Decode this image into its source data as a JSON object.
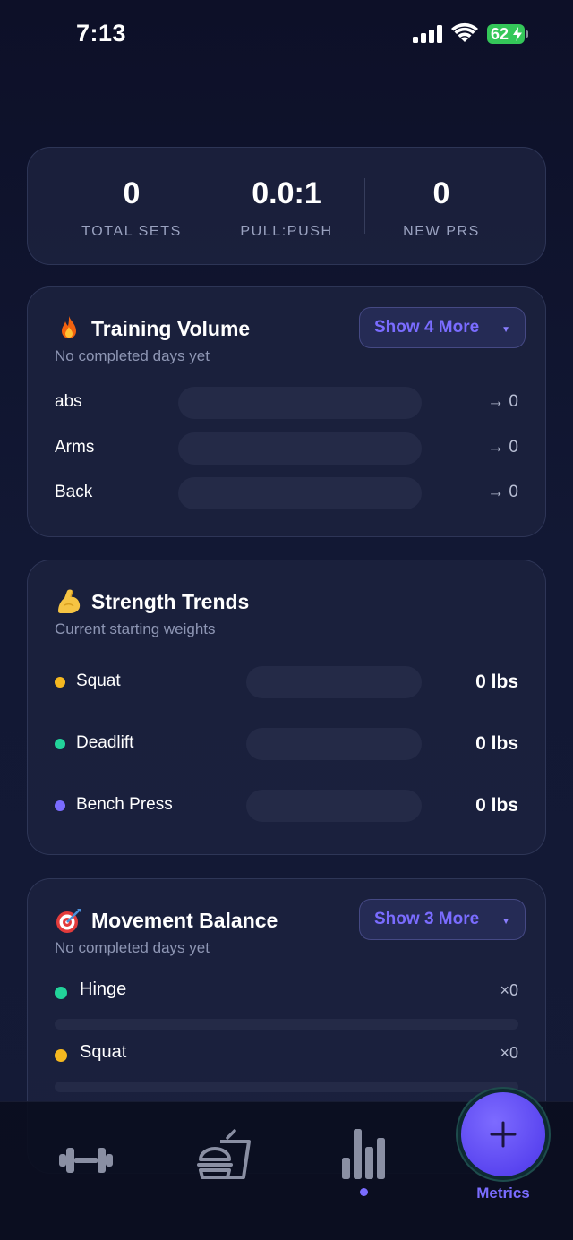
{
  "status_bar": {
    "time": "7:13",
    "battery": "62"
  },
  "stats": [
    {
      "value": "0",
      "label": "TOTAL SETS"
    },
    {
      "value": "0.0:1",
      "label": "PULL:PUSH"
    },
    {
      "value": "0",
      "label": "NEW PRS"
    }
  ],
  "training_volume": {
    "title": "Training Volume",
    "subtitle": "No completed days yet",
    "more_label": "Show 4 More",
    "rows": [
      {
        "label": "abs",
        "value": "→ 0"
      },
      {
        "label": "Arms",
        "value": "→ 0"
      },
      {
        "label": "Back",
        "value": "→ 0"
      }
    ]
  },
  "strength_trends": {
    "title": "Strength Trends",
    "subtitle": "Current starting weights",
    "rows": [
      {
        "label": "Squat",
        "value": "0 lbs",
        "color": "#f5b820"
      },
      {
        "label": "Deadlift",
        "value": "0 lbs",
        "color": "#22d39a"
      },
      {
        "label": "Bench Press",
        "value": "0 lbs",
        "color": "#7a6cff"
      }
    ]
  },
  "movement_balance": {
    "title": "Movement Balance",
    "subtitle": "No completed days yet",
    "more_label": "Show 3 More",
    "rows": [
      {
        "label": "Hinge",
        "count": "×0",
        "color": "#22d39a"
      },
      {
        "label": "Squat",
        "count": "×0",
        "color": "#f5b820"
      }
    ]
  },
  "tab_bar": {
    "tabs": [
      {
        "icon": "dumbbell-icon"
      },
      {
        "icon": "burger-drink-icon"
      },
      {
        "icon": "bar-chart-icon",
        "active": true
      }
    ],
    "fab_label": "Metrics"
  },
  "colors": {
    "accent": "#7a6cff",
    "battery": "#34c759",
    "card": "#1c223e"
  }
}
